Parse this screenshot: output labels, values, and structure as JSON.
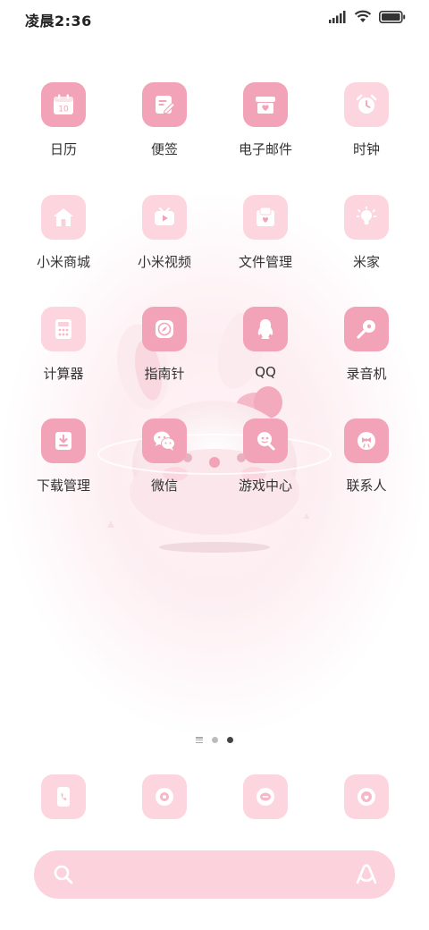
{
  "status": {
    "time": "凌晨2:36"
  },
  "apps": [
    {
      "label": "日历",
      "icon": "calendar-icon",
      "calendar_day": "10"
    },
    {
      "label": "便签",
      "icon": "notes-icon"
    },
    {
      "label": "电子邮件",
      "icon": "mail-icon"
    },
    {
      "label": "时钟",
      "icon": "clock-icon"
    },
    {
      "label": "小米商城",
      "icon": "store-icon"
    },
    {
      "label": "小米视频",
      "icon": "video-icon"
    },
    {
      "label": "文件管理",
      "icon": "folder-icon"
    },
    {
      "label": "米家",
      "icon": "lightbulb-icon"
    },
    {
      "label": "计算器",
      "icon": "calculator-icon"
    },
    {
      "label": "指南针",
      "icon": "compass-icon"
    },
    {
      "label": "QQ",
      "icon": "qq-penguin-icon"
    },
    {
      "label": "录音机",
      "icon": "microphone-icon"
    },
    {
      "label": "下载管理",
      "icon": "download-icon"
    },
    {
      "label": "微信",
      "icon": "wechat-icon"
    },
    {
      "label": "游戏中心",
      "icon": "game-icon"
    },
    {
      "label": "联系人",
      "icon": "contacts-icon"
    }
  ],
  "dock": [
    {
      "icon": "phone-icon"
    },
    {
      "icon": "camera-icon"
    },
    {
      "icon": "message-icon"
    },
    {
      "icon": "browser-icon"
    }
  ],
  "pages": {
    "total": 2,
    "current": 2
  },
  "colors": {
    "tile_dark": "#f2a3b8",
    "tile_light": "#fcd5df",
    "search_bg": "#fcd3dc"
  }
}
